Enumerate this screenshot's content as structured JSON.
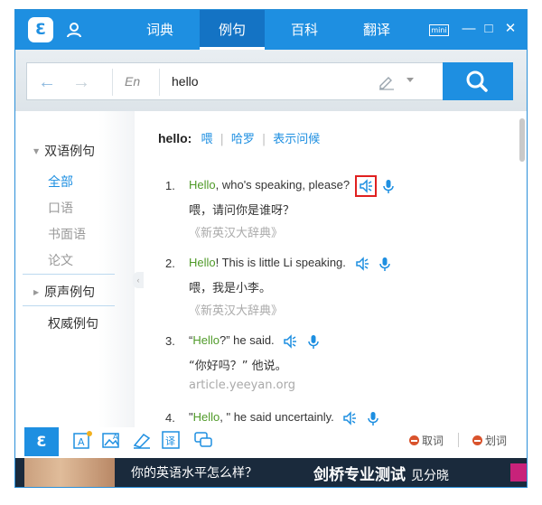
{
  "titlebar": {
    "logo_text": "Ɛ",
    "tabs": [
      {
        "label": "词典",
        "active": false
      },
      {
        "label": "例句",
        "active": true
      },
      {
        "label": "百科",
        "active": false
      },
      {
        "label": "翻译",
        "active": false
      }
    ],
    "mini_label": "mini",
    "minimize_glyph": "—",
    "maximize_glyph": "□",
    "close_glyph": "✕",
    "accent_color": "#1e8fe1"
  },
  "search": {
    "back_glyph": "←",
    "forward_glyph": "→",
    "language": "En",
    "query": "hello"
  },
  "sidebar": {
    "bilingual_header": "双语例句",
    "items": [
      {
        "label": "全部",
        "active": true
      },
      {
        "label": "口语",
        "active": false
      },
      {
        "label": "书面语",
        "active": false
      },
      {
        "label": "论文",
        "active": false
      }
    ],
    "original_voice": "原声例句",
    "authority": "权威例句",
    "collapse_glyph": "‹"
  },
  "content": {
    "word": "hello:",
    "senses": [
      "喂",
      "哈罗",
      "表示问候"
    ],
    "examples": [
      {
        "num": "1.",
        "pre": "",
        "kw": "Hello",
        "post": ", who's speaking, please?",
        "zh": "喂，请问你是谁呀？",
        "src": "《新英汉大辞典》",
        "speaker_highlighted": true
      },
      {
        "num": "2.",
        "pre": "",
        "kw": "Hello",
        "post": "! This is little Li speaking.",
        "zh": "喂，我是小李。",
        "src": "《新英汉大辞典》",
        "speaker_highlighted": false
      },
      {
        "num": "3.",
        "pre": "“",
        "kw": "Hello",
        "post": "?” he said.",
        "zh": "“你好吗？” 他说。",
        "src": "article.yeeyan.org",
        "speaker_highlighted": false
      },
      {
        "num": "4.",
        "pre": "\"",
        "kw": "Hello",
        "post": ", \" he said uncertainly.",
        "zh": "",
        "src": "",
        "speaker_highlighted": false
      }
    ]
  },
  "bottombar": {
    "logo_text": "Ɛ",
    "tools": [
      "screen-translate-icon",
      "image-translate-icon",
      "highlight-word-icon",
      "translate-icon",
      "chat-icon"
    ],
    "option_1": "取词",
    "option_2": "划词"
  },
  "ad": {
    "question": "你的英语水平怎么样？",
    "headline": "剑桥专业测试",
    "cta": "见分晓"
  }
}
